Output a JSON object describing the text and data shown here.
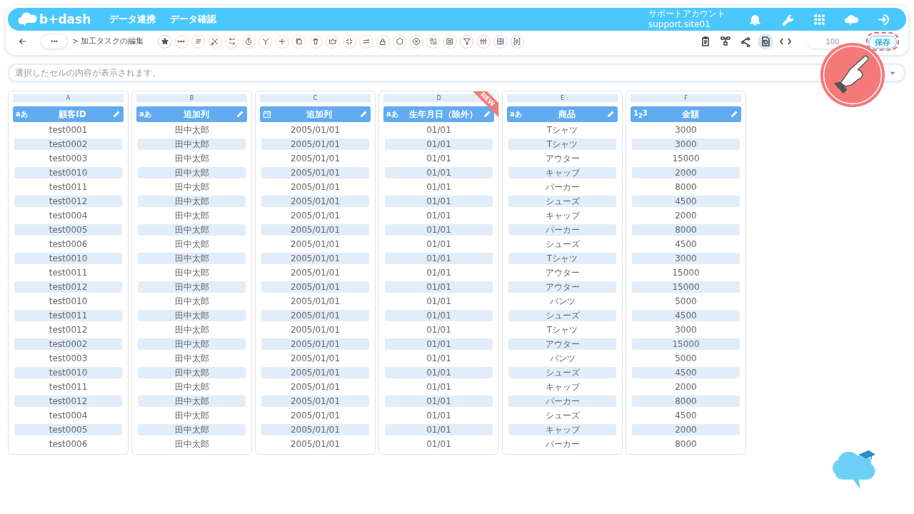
{
  "nav": {
    "logo": "b+dash",
    "links": [
      "データ連携",
      "データ確認"
    ],
    "account_name": "サポートアカウント",
    "account_id": "support.site01"
  },
  "toolbar": {
    "more": "•••",
    "breadcrumb": "> 加工タスクの編集",
    "tools": [
      {
        "color": "#b9d3ee"
      },
      {
        "color": "#f3e2b6"
      },
      {
        "color": "#f3e2b6"
      },
      {
        "color": "#f3e2b6"
      },
      {
        "color": "#f3e2b6"
      },
      {
        "color": "#f3e2b6"
      },
      {
        "color": "#f3e2b6"
      },
      {
        "color": "#f3e2b6"
      },
      {
        "color": "#f3e2b6"
      },
      {
        "color": "#f3e2b6"
      },
      {
        "color": "#f3e2b6"
      },
      {
        "color": "#f3e2b6"
      },
      {
        "color": "#f3e2b6"
      },
      {
        "color": "#e0e6c8"
      },
      {
        "color": "#e0e6c8"
      },
      {
        "color": "#e0e6c8"
      },
      {
        "color": "#e0e6c8"
      },
      {
        "color": "#e0e6c8"
      },
      {
        "color": "#f5c6c6"
      },
      {
        "color": "#f5c6c6"
      },
      {
        "color": "#edd2f6"
      },
      {
        "color": "#edd2f6"
      }
    ],
    "views": [
      {
        "selected": false
      },
      {
        "selected": false
      },
      {
        "selected": false
      },
      {
        "selected": true
      },
      {
        "selected": false
      }
    ],
    "zoom": "100",
    "save": "保存"
  },
  "cell_bar": {
    "placeholder": "選択したセルの内容が表示されます。"
  },
  "columns": [
    {
      "letter": "A",
      "kind": "text",
      "badge": "aあ",
      "header": "顧客ID",
      "new": false,
      "cells": [
        "test0001",
        "test0002",
        "test0003",
        "test0010",
        "test0011",
        "test0012",
        "test0004",
        "test0005",
        "test0006",
        "test0010",
        "test0011",
        "test0012",
        "test0010",
        "test0011",
        "test0012",
        "test0002",
        "test0003",
        "test0010",
        "test0011",
        "test0012",
        "test0004",
        "test0005",
        "test0006"
      ]
    },
    {
      "letter": "B",
      "kind": "text",
      "badge": "aあ",
      "header": "追加列",
      "new": false,
      "cells": [
        "田中太郎",
        "田中太郎",
        "田中太郎",
        "田中太郎",
        "田中太郎",
        "田中太郎",
        "田中太郎",
        "田中太郎",
        "田中太郎",
        "田中太郎",
        "田中太郎",
        "田中太郎",
        "田中太郎",
        "田中太郎",
        "田中太郎",
        "田中太郎",
        "田中太郎",
        "田中太郎",
        "田中太郎",
        "田中太郎",
        "田中太郎",
        "田中太郎",
        "田中太郎"
      ]
    },
    {
      "letter": "C",
      "kind": "date",
      "header": "追加列",
      "new": false,
      "cells": [
        "2005/01/01",
        "2005/01/01",
        "2005/01/01",
        "2005/01/01",
        "2005/01/01",
        "2005/01/01",
        "2005/01/01",
        "2005/01/01",
        "2005/01/01",
        "2005/01/01",
        "2005/01/01",
        "2005/01/01",
        "2005/01/01",
        "2005/01/01",
        "2005/01/01",
        "2005/01/01",
        "2005/01/01",
        "2005/01/01",
        "2005/01/01",
        "2005/01/01",
        "2005/01/01",
        "2005/01/01",
        "2005/01/01"
      ]
    },
    {
      "letter": "D",
      "kind": "text",
      "badge": "aあ",
      "header": "生年月日（除外）",
      "new": true,
      "new_label": "NEW",
      "cells": [
        "01/01",
        "01/01",
        "01/01",
        "01/01",
        "01/01",
        "01/01",
        "01/01",
        "01/01",
        "01/01",
        "01/01",
        "01/01",
        "01/01",
        "01/01",
        "01/01",
        "01/01",
        "01/01",
        "01/01",
        "01/01",
        "01/01",
        "01/01",
        "01/01",
        "01/01",
        "01/01"
      ]
    },
    {
      "letter": "E",
      "kind": "text",
      "badge": "aあ",
      "header": "商品",
      "new": false,
      "cells": [
        "Tシャツ",
        "Tシャツ",
        "アウター",
        "キャップ",
        "パーカー",
        "シューズ",
        "キャップ",
        "パーカー",
        "シューズ",
        "Tシャツ",
        "アウター",
        "アウター",
        "パンツ",
        "シューズ",
        "Tシャツ",
        "アウター",
        "パンツ",
        "シューズ",
        "キャップ",
        "パーカー",
        "シューズ",
        "キャップ",
        "パーカー"
      ]
    },
    {
      "letter": "F",
      "kind": "number",
      "badge": "1$_{2}$3",
      "header": "金額",
      "new": false,
      "cells": [
        "3000",
        "3000",
        "15000",
        "2000",
        "8000",
        "4500",
        "2000",
        "8000",
        "4500",
        "3000",
        "15000",
        "15000",
        "5000",
        "4500",
        "3000",
        "15000",
        "5000",
        "4500",
        "2000",
        "8000",
        "4500",
        "2000",
        "8000"
      ]
    }
  ]
}
